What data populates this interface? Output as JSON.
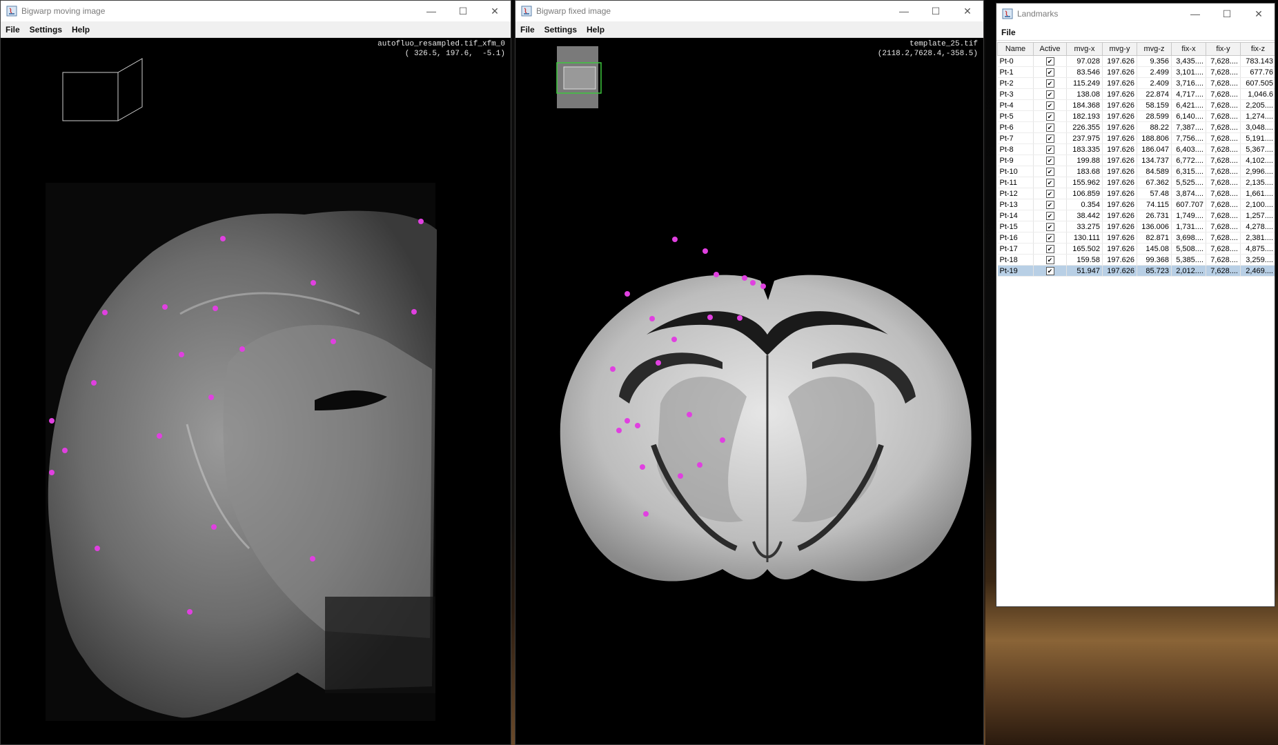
{
  "colors": {
    "landmark": "#e040e0",
    "accent": "#3ec83e"
  },
  "moving_window": {
    "title": "Bigwarp moving image",
    "menus": [
      "File",
      "Settings",
      "Help"
    ],
    "overlay_line1": "autofluo_resampled.tif_xfm_0",
    "overlay_line2": "( 326.5, 197.6,  -5.1)"
  },
  "fixed_window": {
    "title": "Bigwarp fixed image",
    "menus": [
      "File",
      "Settings",
      "Help"
    ],
    "overlay_line1": "template_25.tif",
    "overlay_line2": "(2118.2,7628.4,-358.5)"
  },
  "landmarks_window": {
    "title": "Landmarks",
    "menu_file": "File",
    "columns": [
      "Name",
      "Active",
      "mvg-x",
      "mvg-y",
      "mvg-z",
      "fix-x",
      "fix-y",
      "fix-z"
    ],
    "rows": [
      [
        "Pt-0",
        "✔",
        "97.028",
        "197.626",
        "9.356",
        "3,435....",
        "7,628....",
        "783.143"
      ],
      [
        "Pt-1",
        "✔",
        "83.546",
        "197.626",
        "2.499",
        "3,101....",
        "7,628....",
        "677.76"
      ],
      [
        "Pt-2",
        "✔",
        "115.249",
        "197.626",
        "2.409",
        "3,716....",
        "7,628....",
        "607.505"
      ],
      [
        "Pt-3",
        "✔",
        "138.08",
        "197.626",
        "22.874",
        "4,717....",
        "7,628....",
        "1,046.6"
      ],
      [
        "Pt-4",
        "✔",
        "184.368",
        "197.626",
        "58.159",
        "6,421....",
        "7,628....",
        "2,205...."
      ],
      [
        "Pt-5",
        "✔",
        "182.193",
        "197.626",
        "28.599",
        "6,140....",
        "7,628....",
        "1,274...."
      ],
      [
        "Pt-6",
        "✔",
        "226.355",
        "197.626",
        "88.22",
        "7,387....",
        "7,628....",
        "3,048...."
      ],
      [
        "Pt-7",
        "✔",
        "237.975",
        "197.626",
        "188.806",
        "7,756....",
        "7,628....",
        "5,191...."
      ],
      [
        "Pt-8",
        "✔",
        "183.335",
        "197.626",
        "186.047",
        "6,403....",
        "7,628....",
        "5,367...."
      ],
      [
        "Pt-9",
        "✔",
        "199.88",
        "197.626",
        "134.737",
        "6,772....",
        "7,628....",
        "4,102...."
      ],
      [
        "Pt-10",
        "✔",
        "183.68",
        "197.626",
        "84.589",
        "6,315....",
        "7,628....",
        "2,996...."
      ],
      [
        "Pt-11",
        "✔",
        "155.962",
        "197.626",
        "67.362",
        "5,525....",
        "7,628....",
        "2,135...."
      ],
      [
        "Pt-12",
        "✔",
        "106.859",
        "197.626",
        "57.48",
        "3,874....",
        "7,628....",
        "1,661...."
      ],
      [
        "Pt-13",
        "✔",
        "0.354",
        "197.626",
        "74.115",
        "607.707",
        "7,628....",
        "2,100...."
      ],
      [
        "Pt-14",
        "✔",
        "38.442",
        "197.626",
        "26.731",
        "1,749....",
        "7,628....",
        "1,257...."
      ],
      [
        "Pt-15",
        "✔",
        "33.275",
        "197.626",
        "136.006",
        "1,731....",
        "7,628....",
        "4,278...."
      ],
      [
        "Pt-16",
        "✔",
        "130.111",
        "197.626",
        "82.871",
        "3,698....",
        "7,628....",
        "2,381...."
      ],
      [
        "Pt-17",
        "✔",
        "165.502",
        "197.626",
        "145.08",
        "5,508....",
        "7,628....",
        "4,875...."
      ],
      [
        "Pt-18",
        "✔",
        "159.58",
        "197.626",
        "99.368",
        "5,385....",
        "7,628....",
        "3,259...."
      ],
      [
        "Pt-19",
        "✔",
        "51.947",
        "197.626",
        "85.723",
        "2,012....",
        "7,628....",
        "2,469...."
      ]
    ],
    "selected_row": "Pt-19"
  }
}
